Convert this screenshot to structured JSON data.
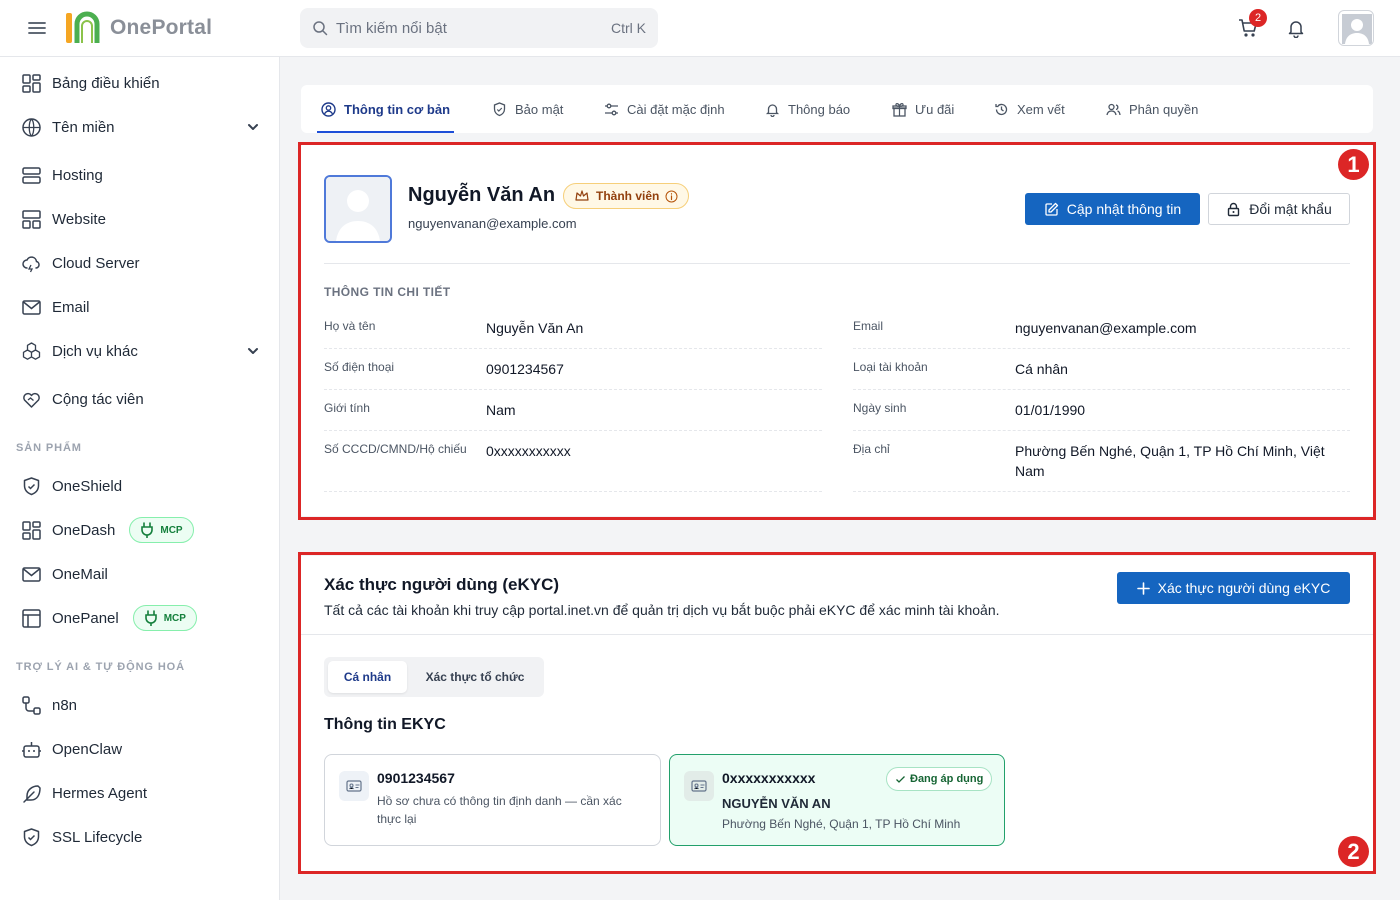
{
  "app": {
    "logo_text": "OnePortal"
  },
  "search": {
    "placeholder": "Tìm kiếm nổi bật",
    "shortcut": "Ctrl K"
  },
  "header": {
    "cart_count": "2"
  },
  "sidebar": {
    "items": [
      {
        "label": "Bảng điều khiển",
        "icon": "dashboard-icon"
      },
      {
        "label": "Tên miền",
        "icon": "globe-icon"
      },
      {
        "label": "Hosting",
        "icon": "server-icon"
      },
      {
        "label": "Website",
        "icon": "layout-icon"
      },
      {
        "label": "Cloud Server",
        "icon": "cloud-icon"
      },
      {
        "label": "Email",
        "icon": "mail-icon"
      },
      {
        "label": "Dịch vụ khác",
        "icon": "boxes-icon"
      },
      {
        "label": "Cộng tác viên",
        "icon": "handshake-icon"
      }
    ],
    "section_products": "SẢN PHẨM",
    "products": [
      {
        "label": "OneShield",
        "icon": "shield-icon"
      },
      {
        "label": "OneDash",
        "icon": "dashboard-icon",
        "badge": "MCP"
      },
      {
        "label": "OneMail",
        "icon": "mail-icon"
      },
      {
        "label": "OnePanel",
        "icon": "panel-icon",
        "badge": "MCP"
      }
    ],
    "section_ai": "TRỢ LÝ AI & TỰ ĐỘNG HOÁ",
    "ai": [
      {
        "label": "n8n",
        "icon": "workflow-icon"
      },
      {
        "label": "OpenClaw",
        "icon": "bot-icon"
      },
      {
        "label": "Hermes Agent",
        "icon": "feather-icon"
      },
      {
        "label": "SSL Lifecycle",
        "icon": "shield-check-icon"
      }
    ]
  },
  "tabs": [
    {
      "label": "Thông tin cơ bản",
      "active": true
    },
    {
      "label": "Bảo mật"
    },
    {
      "label": "Cài đặt mặc định"
    },
    {
      "label": "Thông báo"
    },
    {
      "label": "Ưu đãi"
    },
    {
      "label": "Xem vết"
    },
    {
      "label": "Phân quyền"
    }
  ],
  "profile": {
    "name": "Nguyễn Văn An",
    "badge": "Thành viên",
    "email": "nguyenvanan@example.com",
    "update_button": "Cập nhật thông tin",
    "password_button": "Đổi mật khẩu",
    "detail_title": "THÔNG TIN CHI TIẾT",
    "fields_left": [
      {
        "label": "Họ và tên",
        "value": "Nguyễn Văn An"
      },
      {
        "label": "Số điện thoại",
        "value": "0901234567"
      },
      {
        "label": "Giới tính",
        "value": "Nam"
      },
      {
        "label": "Số CCCD/CMND/Hộ chiếu",
        "value": "0xxxxxxxxxxx"
      }
    ],
    "fields_right": [
      {
        "label": "Email",
        "value": "nguyenvanan@example.com"
      },
      {
        "label": "Loại tài khoản",
        "value": "Cá nhân"
      },
      {
        "label": "Ngày sinh",
        "value": "01/01/1990"
      },
      {
        "label": "Địa chỉ",
        "value": "Phường Bến Nghé, Quận 1, TP Hồ Chí Minh, Việt Nam"
      }
    ]
  },
  "ekyc": {
    "title": "Xác thực người dùng (eKYC)",
    "description": "Tất cả các tài khoản khi truy cập portal.inet.vn để quản trị dịch vụ bắt buộc phải eKYC để xác minh tài khoản.",
    "button": "Xác thực người dùng eKYC",
    "seg_personal": "Cá nhân",
    "seg_org": "Xác thực tổ chức",
    "subtitle": "Thông tin EKYC",
    "cards": [
      {
        "title": "0901234567",
        "desc": "Hồ sơ chưa có thông tin định danh — cần xác thực lại"
      },
      {
        "title": "0xxxxxxxxxxx",
        "status": "Đang áp dụng",
        "name": "NGUYỄN VĂN AN",
        "address": "Phường Bến Nghé, Quận 1, TP Hồ Chí Minh"
      }
    ]
  },
  "annotations": {
    "one": "1",
    "two": "2"
  },
  "colors": {
    "primary": "#1565c0",
    "accent_red": "#dc2626",
    "brand_green": "#4caf50",
    "brand_orange": "#f5a623"
  }
}
